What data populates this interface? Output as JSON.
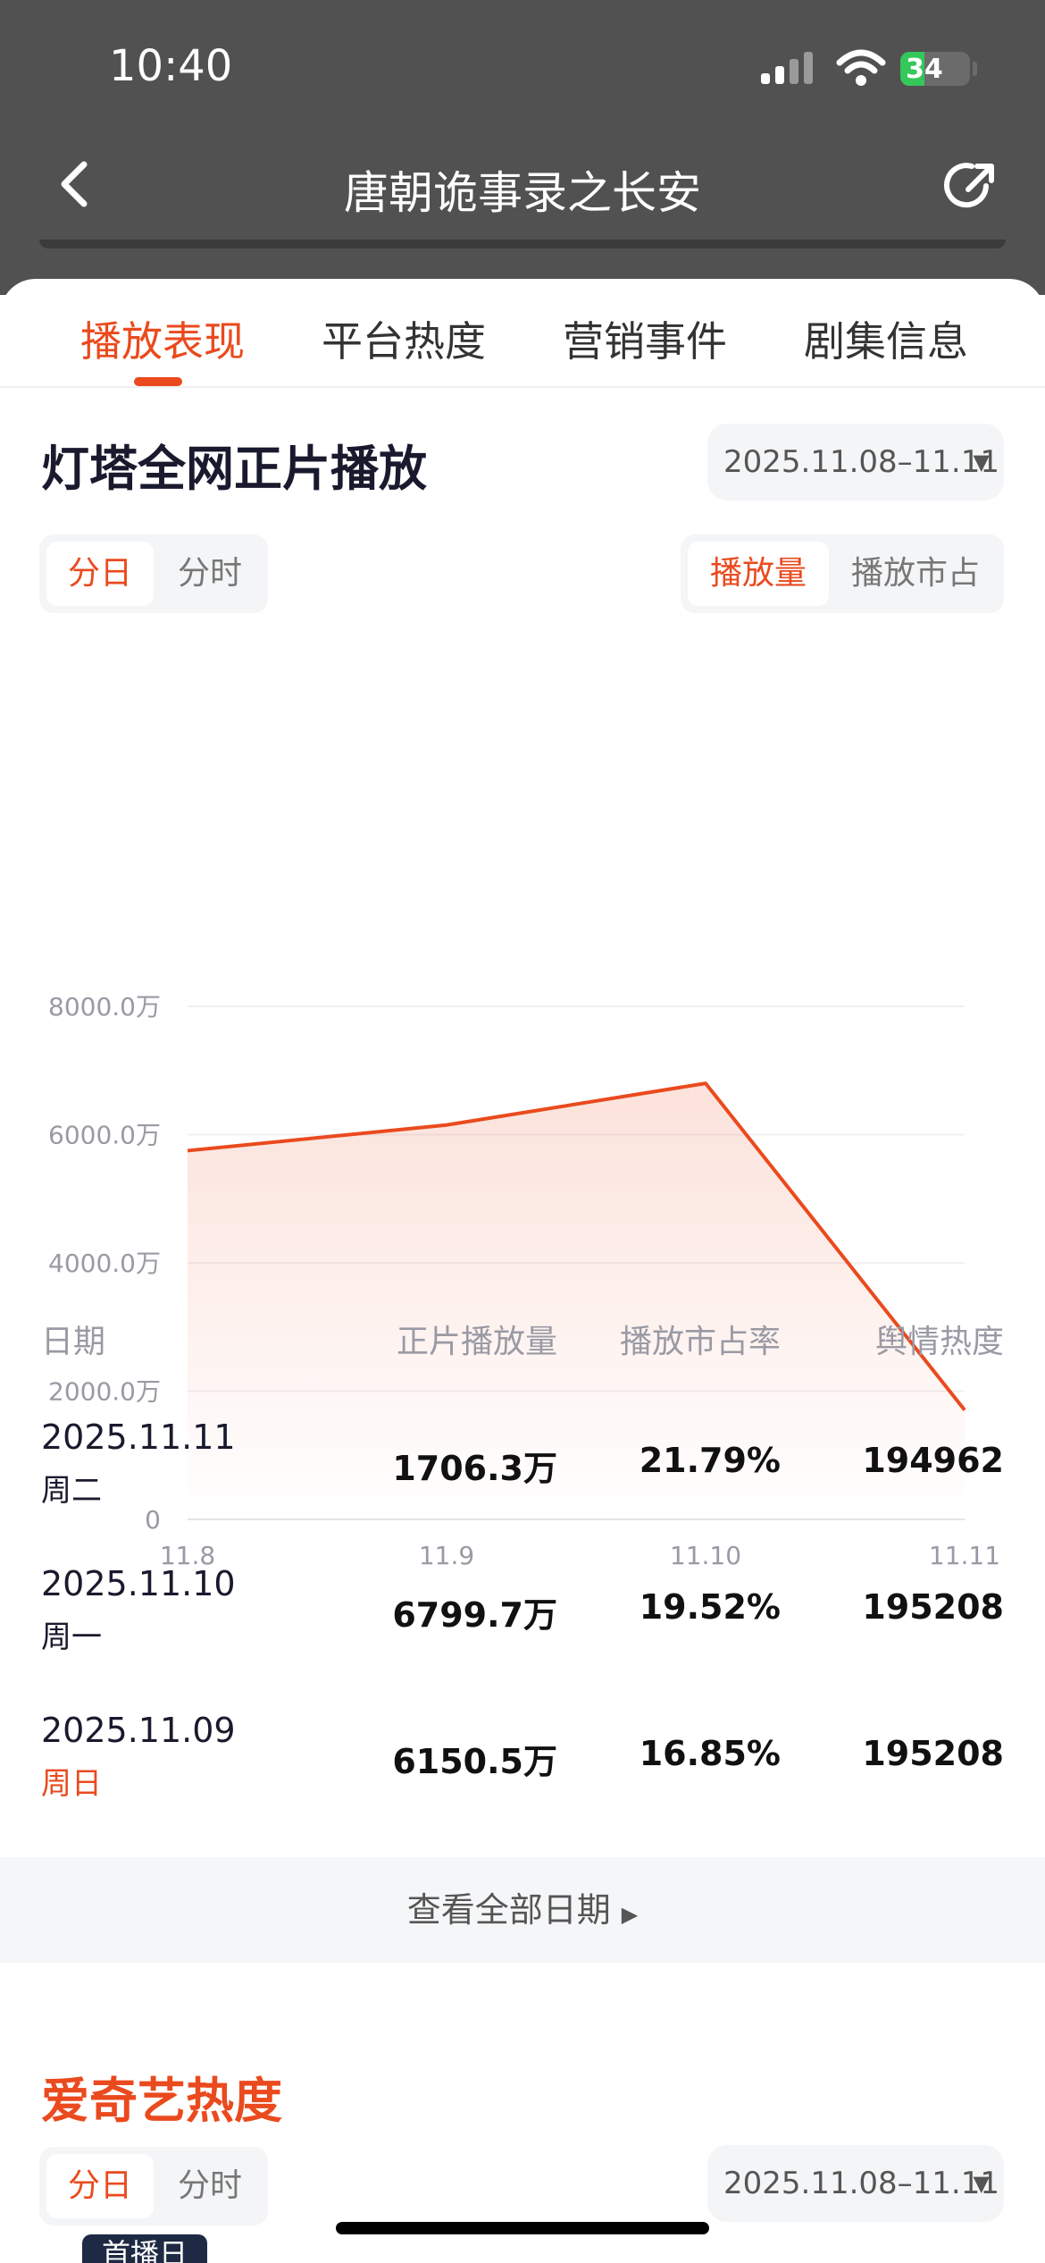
{
  "status_bar": {
    "time": "10:40",
    "battery": "34",
    "battery_level_pct": 34
  },
  "nav": {
    "title": "唐朝诡事录之长安"
  },
  "tabs": [
    {
      "label": "播放表现",
      "active": true
    },
    {
      "label": "平台热度",
      "active": false
    },
    {
      "label": "营销事件",
      "active": false
    },
    {
      "label": "剧集信息",
      "active": false
    }
  ],
  "playback": {
    "title": "灯塔全网正片播放",
    "date_range": "2025.11.08–11.11",
    "granularity": {
      "day": "分日",
      "hour": "分时",
      "selected": "分日"
    },
    "metric": {
      "plays": "播放量",
      "share": "播放市占",
      "selected": "播放量"
    }
  },
  "chart_data": {
    "type": "area",
    "x": [
      "11.8",
      "11.9",
      "11.10",
      "11.11"
    ],
    "values": [
      5750,
      6150.5,
      6799.7,
      1706.3
    ],
    "unit": "万",
    "ylim": [
      0,
      8000
    ],
    "yticks": [
      "8000.0万",
      "6000.0万",
      "4000.0万",
      "2000.0万",
      "0"
    ],
    "grid": true,
    "color": "#ea4a1e"
  },
  "table": {
    "headers": [
      "日期",
      "正片播放量",
      "播放市占率",
      "舆情热度"
    ],
    "rows": [
      {
        "date": "2025.11.11",
        "weekday": "周二",
        "weekend": false,
        "plays": "1706.3万",
        "share": "21.79%",
        "heat": "194962"
      },
      {
        "date": "2025.11.10",
        "weekday": "周一",
        "weekend": false,
        "plays": "6799.7万",
        "share": "19.52%",
        "heat": "195208"
      },
      {
        "date": "2025.11.09",
        "weekday": "周日",
        "weekend": true,
        "plays": "6150.5万",
        "share": "16.85%",
        "heat": "195208"
      }
    ]
  },
  "view_all": "查看全部日期",
  "iqiyi": {
    "title": "爱奇艺热度",
    "date_range": "2025.11.08–11.11",
    "granularity": {
      "day": "分日",
      "hour": "分时",
      "selected": "分日"
    },
    "badge": "首播日"
  },
  "colors": {
    "accent": "#ea4a1e",
    "header_bg": "#515151",
    "pill_bg": "#f4f5f7"
  }
}
